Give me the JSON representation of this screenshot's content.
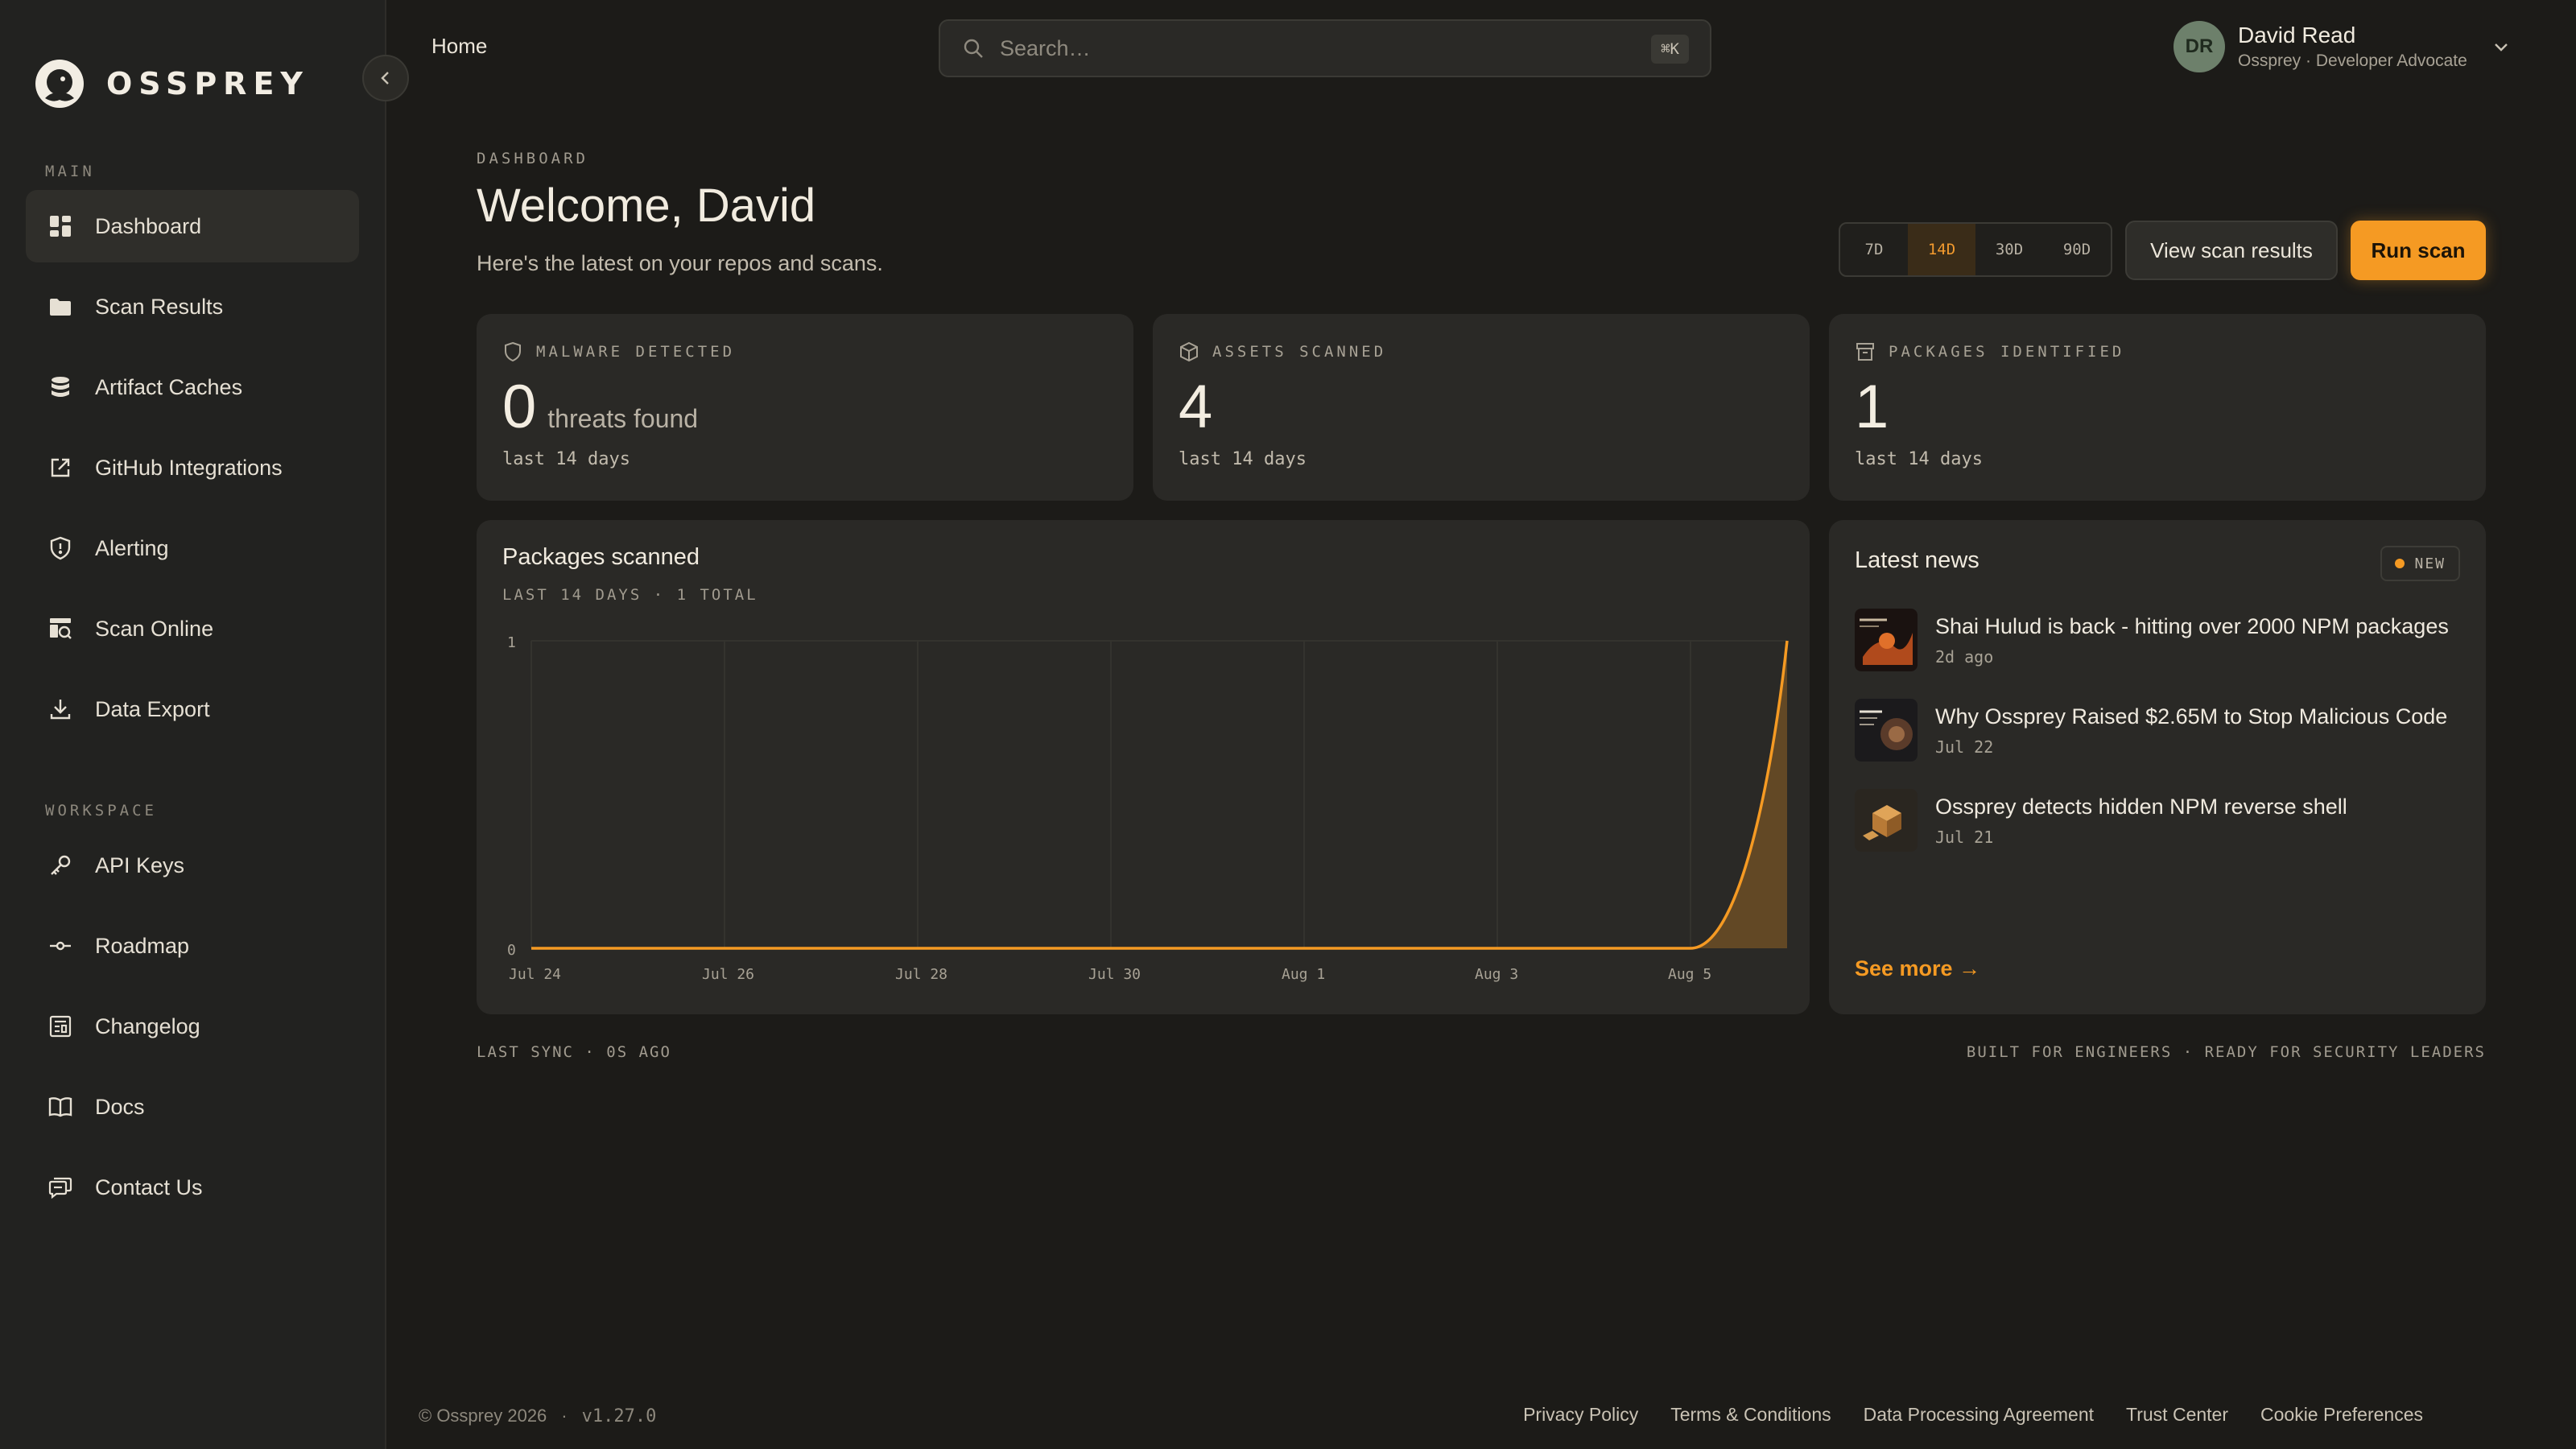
{
  "brand": {
    "name": "OSSPREY",
    "accent": "#f59a23"
  },
  "sidebar": {
    "main_label": "MAIN",
    "workspace_label": "WORKSPACE",
    "main_items": [
      {
        "label": "Dashboard",
        "icon": "dashboard-icon",
        "active": true
      },
      {
        "label": "Scan Results",
        "icon": "folder-icon"
      },
      {
        "label": "Artifact Caches",
        "icon": "database-icon"
      },
      {
        "label": "GitHub Integrations",
        "icon": "external-link-icon"
      },
      {
        "label": "Alerting",
        "icon": "shield-icon"
      },
      {
        "label": "Scan Online",
        "icon": "scan-icon"
      },
      {
        "label": "Data Export",
        "icon": "download-icon"
      }
    ],
    "workspace_items": [
      {
        "label": "API Keys",
        "icon": "key-icon"
      },
      {
        "label": "Roadmap",
        "icon": "commit-icon"
      },
      {
        "label": "Changelog",
        "icon": "changelog-icon"
      },
      {
        "label": "Docs",
        "icon": "book-icon"
      },
      {
        "label": "Contact Us",
        "icon": "chat-icon"
      }
    ]
  },
  "topbar": {
    "breadcrumb": "Home",
    "search_placeholder": "Search…",
    "search_shortcut": "⌘K",
    "user": {
      "initials": "DR",
      "name": "David Read",
      "role": "Ossprey · Developer Advocate"
    }
  },
  "header": {
    "kicker": "DASHBOARD",
    "title": "Welcome, David",
    "subtitle": "Here's the latest on your repos and scans.",
    "ranges": [
      "7D",
      "14D",
      "30D",
      "90D"
    ],
    "selected_range": "14D",
    "view_results_label": "View scan results",
    "run_scan_label": "Run scan"
  },
  "stats": [
    {
      "label": "MALWARE DETECTED",
      "value": "0",
      "suffix": "threats found",
      "period": "last 14 days",
      "icon": "shield-icon"
    },
    {
      "label": "ASSETS SCANNED",
      "value": "4",
      "suffix": "",
      "period": "last 14 days",
      "icon": "box-icon"
    },
    {
      "label": "PACKAGES IDENTIFIED",
      "value": "1",
      "suffix": "",
      "period": "last 14 days",
      "icon": "archive-icon"
    }
  ],
  "chart": {
    "title": "Packages scanned",
    "subtitle": "LAST 14 DAYS · 1 TOTAL"
  },
  "chart_data": {
    "type": "area",
    "title": "Packages scanned",
    "x": [
      "Jul 24",
      "Jul 25",
      "Jul 26",
      "Jul 27",
      "Jul 28",
      "Jul 29",
      "Jul 30",
      "Jul 31",
      "Aug 1",
      "Aug 2",
      "Aug 3",
      "Aug 4",
      "Aug 5",
      "Aug 6"
    ],
    "x_tick_labels": [
      "Jul 24",
      "Jul 26",
      "Jul 28",
      "Jul 30",
      "Aug 1",
      "Aug 3",
      "Aug 5"
    ],
    "series": [
      {
        "values": [
          0,
          0,
          0,
          0,
          0,
          0,
          0,
          0,
          0,
          0,
          0,
          0,
          0,
          1
        ]
      }
    ],
    "ylim": [
      0,
      1
    ],
    "y_tick_labels": [
      "0",
      "1"
    ],
    "grid": true,
    "color": "#f59a23"
  },
  "news": {
    "title": "Latest news",
    "badge": "NEW",
    "items": [
      {
        "headline": "Shai Hulud is back - hitting over 2000 NPM packages",
        "date": "2d ago"
      },
      {
        "headline": "Why Ossprey Raised $2.65M to Stop Malicious Code",
        "date": "Jul 22"
      },
      {
        "headline": "Ossprey detects hidden NPM reverse shell",
        "date": "Jul 21"
      }
    ],
    "see_more": "See more →"
  },
  "status": {
    "sync": "LAST SYNC · 0S AGO",
    "tagline": "BUILT FOR ENGINEERS · READY FOR SECURITY LEADERS"
  },
  "footer": {
    "copyright": "© Ossprey 2026",
    "separator": "·",
    "version": "v1.27.0",
    "links": [
      "Privacy Policy",
      "Terms & Conditions",
      "Data Processing Agreement",
      "Trust Center",
      "Cookie Preferences"
    ]
  }
}
